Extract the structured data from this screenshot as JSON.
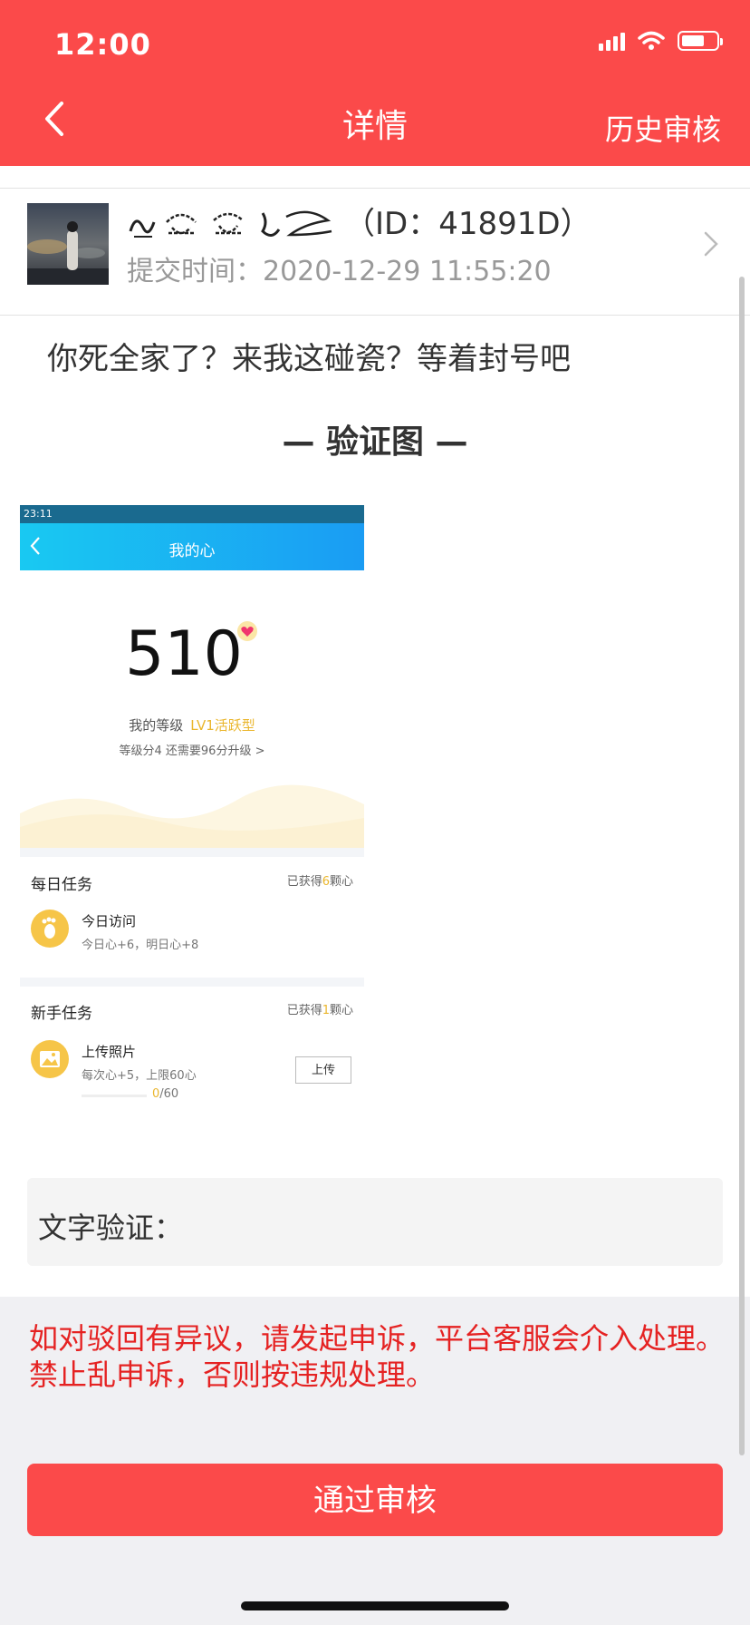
{
  "status_bar": {
    "time": "12:00"
  },
  "header": {
    "title": "详情",
    "history": "历史审核"
  },
  "user": {
    "id": "（ID：41891D）",
    "submit_time": "提交时间：2020-12-29 11:55:20"
  },
  "content": "你死全家了？来我这碰瓷？等着封号吧",
  "section_title": "— 验证图 —",
  "screenshot": {
    "status_time": "23:11",
    "nav_title": "我的心",
    "number": "510",
    "level_label": "我的等级",
    "level_value": "LV1活跃型",
    "level_hint": "等级分4 还需要96分升级 >",
    "daily": {
      "title": "每日任务",
      "earned_prefix": "已获得",
      "earned_count": "6",
      "earned_suffix": "颗心",
      "task_name": "今日访问",
      "task_sub": "今日心+6，明日心+8"
    },
    "newbie": {
      "title": "新手任务",
      "earned_prefix": "已获得",
      "earned_count": "1",
      "earned_suffix": "颗心",
      "task_name": "上传照片",
      "task_sub": "每次心+5，上限60心",
      "progress_current": "0",
      "progress_total": "/60",
      "upload_label": "上传"
    }
  },
  "verify_label": "文字验证：",
  "notice": "如对驳回有异议，请发起申诉，平台客服会介入处理。禁止乱申诉，否则按违规处理。",
  "approve_label": "通过审核",
  "colors": {
    "brand": "#fb4a4a",
    "notice": "#e52222",
    "accent_yellow": "#eab62d"
  }
}
